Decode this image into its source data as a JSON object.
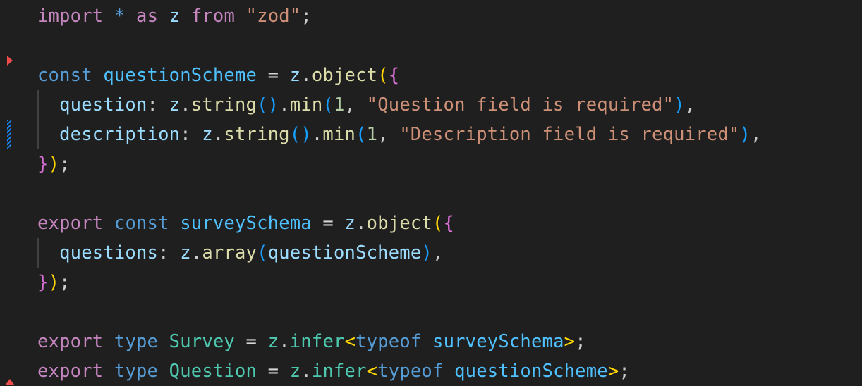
{
  "editor": {
    "language": "typescript",
    "colors": {
      "background": "#1f1f1f",
      "keyword": "#c586c0",
      "declaration": "#569cd6",
      "variable": "#4fc1ff",
      "identifier": "#9cdcfe",
      "function": "#dcdcaa",
      "string": "#ce9178",
      "number": "#b5cea8",
      "type": "#4ec9b0",
      "bracket_level1": "#ffd700",
      "bracket_level2": "#da70d6",
      "bracket_level3": "#179fff",
      "breakpoint_marker": "#f14c4c",
      "modified_marker": "#1b81e8"
    },
    "gutter_markers": [
      {
        "type": "folding-arrow-icon",
        "line": 3
      },
      {
        "type": "modified-line-icon",
        "line": 5
      },
      {
        "type": "deleted-line-icon",
        "line": 13
      }
    ],
    "lines": [
      {
        "tokens": [
          {
            "t": "import",
            "c": "t-kw"
          },
          {
            "t": " ",
            "c": "t-op"
          },
          {
            "t": "*",
            "c": "t-decl"
          },
          {
            "t": " ",
            "c": "t-op"
          },
          {
            "t": "as",
            "c": "t-kw"
          },
          {
            "t": " ",
            "c": "t-op"
          },
          {
            "t": "z",
            "c": "t-id"
          },
          {
            "t": " ",
            "c": "t-op"
          },
          {
            "t": "from",
            "c": "t-kw"
          },
          {
            "t": " ",
            "c": "t-op"
          },
          {
            "t": "\"zod\"",
            "c": "t-str"
          },
          {
            "t": ";",
            "c": "t-punct"
          }
        ]
      },
      {
        "tokens": []
      },
      {
        "tokens": [
          {
            "t": "const",
            "c": "t-decl"
          },
          {
            "t": " ",
            "c": "t-op"
          },
          {
            "t": "questionScheme",
            "c": "t-var"
          },
          {
            "t": " = ",
            "c": "t-op"
          },
          {
            "t": "z",
            "c": "t-id"
          },
          {
            "t": ".",
            "c": "t-punct"
          },
          {
            "t": "object",
            "c": "t-fn"
          },
          {
            "t": "(",
            "c": "t-b1"
          },
          {
            "t": "{",
            "c": "t-b2"
          }
        ]
      },
      {
        "tokens": [
          {
            "t": "  ",
            "c": "t-op"
          },
          {
            "t": "question",
            "c": "t-id"
          },
          {
            "t": ": ",
            "c": "t-punct"
          },
          {
            "t": "z",
            "c": "t-id"
          },
          {
            "t": ".",
            "c": "t-punct"
          },
          {
            "t": "string",
            "c": "t-fn"
          },
          {
            "t": "()",
            "c": "t-b3"
          },
          {
            "t": ".",
            "c": "t-punct"
          },
          {
            "t": "min",
            "c": "t-fn"
          },
          {
            "t": "(",
            "c": "t-b3"
          },
          {
            "t": "1",
            "c": "t-num"
          },
          {
            "t": ", ",
            "c": "t-punct"
          },
          {
            "t": "\"Question field is required\"",
            "c": "t-str"
          },
          {
            "t": ")",
            "c": "t-b3"
          },
          {
            "t": ",",
            "c": "t-punct"
          }
        ]
      },
      {
        "tokens": [
          {
            "t": "  ",
            "c": "t-op"
          },
          {
            "t": "description",
            "c": "t-id"
          },
          {
            "t": ": ",
            "c": "t-punct"
          },
          {
            "t": "z",
            "c": "t-id"
          },
          {
            "t": ".",
            "c": "t-punct"
          },
          {
            "t": "string",
            "c": "t-fn"
          },
          {
            "t": "()",
            "c": "t-b3"
          },
          {
            "t": ".",
            "c": "t-punct"
          },
          {
            "t": "min",
            "c": "t-fn"
          },
          {
            "t": "(",
            "c": "t-b3"
          },
          {
            "t": "1",
            "c": "t-num"
          },
          {
            "t": ", ",
            "c": "t-punct"
          },
          {
            "t": "\"Description field is required\"",
            "c": "t-str"
          },
          {
            "t": ")",
            "c": "t-b3"
          },
          {
            "t": ",",
            "c": "t-punct"
          }
        ]
      },
      {
        "tokens": [
          {
            "t": "}",
            "c": "t-b2"
          },
          {
            "t": ")",
            "c": "t-b1"
          },
          {
            "t": ";",
            "c": "t-punct"
          }
        ]
      },
      {
        "tokens": []
      },
      {
        "tokens": [
          {
            "t": "export",
            "c": "t-kw"
          },
          {
            "t": " ",
            "c": "t-op"
          },
          {
            "t": "const",
            "c": "t-decl"
          },
          {
            "t": " ",
            "c": "t-op"
          },
          {
            "t": "surveySchema",
            "c": "t-var"
          },
          {
            "t": " = ",
            "c": "t-op"
          },
          {
            "t": "z",
            "c": "t-id"
          },
          {
            "t": ".",
            "c": "t-punct"
          },
          {
            "t": "object",
            "c": "t-fn"
          },
          {
            "t": "(",
            "c": "t-b1"
          },
          {
            "t": "{",
            "c": "t-b2"
          }
        ]
      },
      {
        "tokens": [
          {
            "t": "  ",
            "c": "t-op"
          },
          {
            "t": "questions",
            "c": "t-id"
          },
          {
            "t": ": ",
            "c": "t-punct"
          },
          {
            "t": "z",
            "c": "t-id"
          },
          {
            "t": ".",
            "c": "t-punct"
          },
          {
            "t": "array",
            "c": "t-fn"
          },
          {
            "t": "(",
            "c": "t-b3"
          },
          {
            "t": "questionScheme",
            "c": "t-id"
          },
          {
            "t": ")",
            "c": "t-b3"
          },
          {
            "t": ",",
            "c": "t-punct"
          }
        ]
      },
      {
        "tokens": [
          {
            "t": "}",
            "c": "t-b2"
          },
          {
            "t": ")",
            "c": "t-b1"
          },
          {
            "t": ";",
            "c": "t-punct"
          }
        ]
      },
      {
        "tokens": []
      },
      {
        "tokens": [
          {
            "t": "export",
            "c": "t-kw"
          },
          {
            "t": " ",
            "c": "t-op"
          },
          {
            "t": "type",
            "c": "t-decl"
          },
          {
            "t": " ",
            "c": "t-op"
          },
          {
            "t": "Survey",
            "c": "t-type"
          },
          {
            "t": " = ",
            "c": "t-op"
          },
          {
            "t": "z",
            "c": "t-type"
          },
          {
            "t": ".",
            "c": "t-punct"
          },
          {
            "t": "infer",
            "c": "t-type"
          },
          {
            "t": "<",
            "c": "t-b1"
          },
          {
            "t": "typeof",
            "c": "t-decl"
          },
          {
            "t": " ",
            "c": "t-op"
          },
          {
            "t": "surveySchema",
            "c": "t-var"
          },
          {
            "t": ">",
            "c": "t-b1"
          },
          {
            "t": ";",
            "c": "t-punct"
          }
        ]
      },
      {
        "tokens": [
          {
            "t": "export",
            "c": "t-kw"
          },
          {
            "t": " ",
            "c": "t-op"
          },
          {
            "t": "type",
            "c": "t-decl"
          },
          {
            "t": " ",
            "c": "t-op"
          },
          {
            "t": "Question",
            "c": "t-type"
          },
          {
            "t": " = ",
            "c": "t-op"
          },
          {
            "t": "z",
            "c": "t-type"
          },
          {
            "t": ".",
            "c": "t-punct"
          },
          {
            "t": "infer",
            "c": "t-type"
          },
          {
            "t": "<",
            "c": "t-b1"
          },
          {
            "t": "typeof",
            "c": "t-decl"
          },
          {
            "t": " ",
            "c": "t-op"
          },
          {
            "t": "questionScheme",
            "c": "t-var"
          },
          {
            "t": ">",
            "c": "t-b1"
          },
          {
            "t": ";",
            "c": "t-punct"
          }
        ]
      }
    ]
  }
}
